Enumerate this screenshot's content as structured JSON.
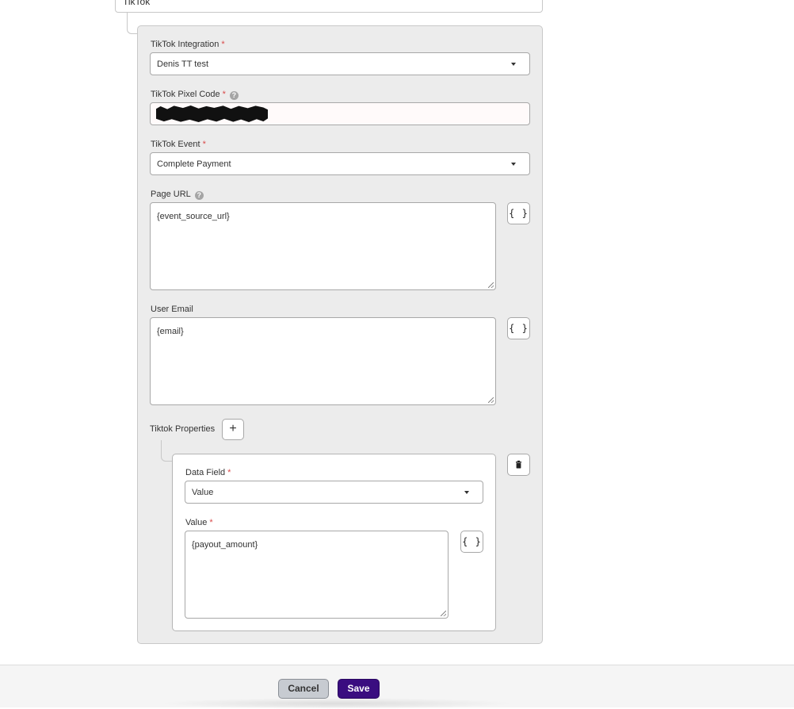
{
  "top_select": {
    "value": "TikTok"
  },
  "form": {
    "integration": {
      "label": "TikTok Integration",
      "required_mark": "*",
      "value": "Denis TT test"
    },
    "pixel_code": {
      "label": "TikTok Pixel Code",
      "required_mark": "*",
      "help_icon": "question-circle-icon",
      "value": ""
    },
    "event": {
      "label": "TikTok Event",
      "required_mark": "*",
      "value": "Complete Payment"
    },
    "page_url": {
      "label": "Page URL",
      "help_icon": "question-circle-icon",
      "value": "{event_source_url}",
      "insert_button": "{ }"
    },
    "user_email": {
      "label": "User Email",
      "value": "{email}",
      "insert_button": "{ }"
    },
    "properties": {
      "label": "Tiktok Properties",
      "add_button": "+",
      "items": [
        {
          "data_field": {
            "label": "Data Field",
            "required_mark": "*",
            "value": "Value"
          },
          "value": {
            "label": "Value",
            "required_mark": "*",
            "value": "{payout_amount}",
            "insert_button": "{ }"
          },
          "delete_icon": "trash-icon"
        }
      ]
    }
  },
  "footer": {
    "cancel_label": "Cancel",
    "save_label": "Save"
  },
  "colors": {
    "save_bg": "#3a0d80",
    "cancel_bg": "#c7cbd1",
    "required": "#d94a4a",
    "panel_bg": "#ececec"
  }
}
